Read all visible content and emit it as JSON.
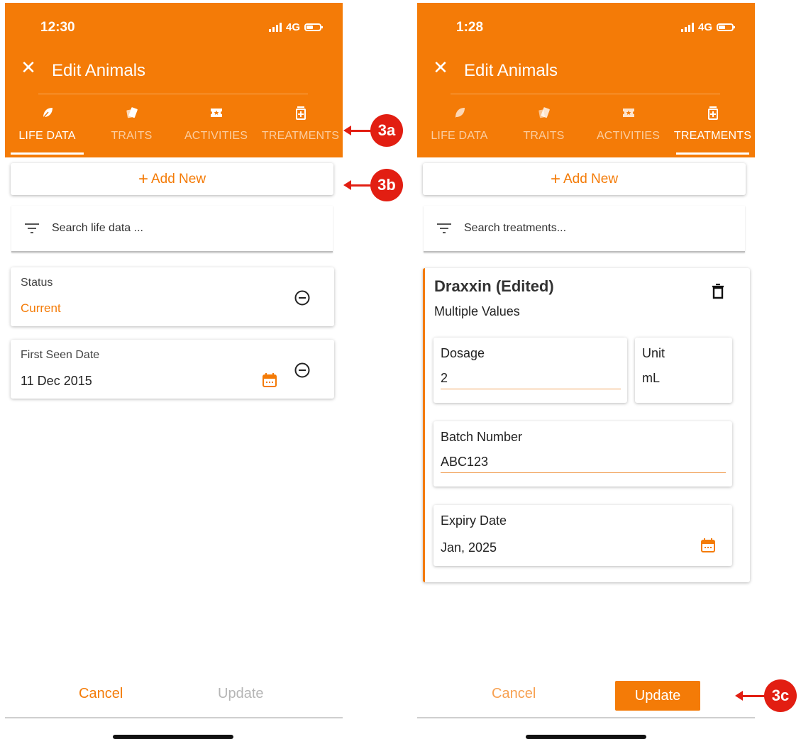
{
  "left": {
    "status": {
      "time": "12:30",
      "network": "4G"
    },
    "title": "Edit Animals",
    "tabs": [
      {
        "label": "LIFE DATA",
        "icon": "leaf-icon",
        "active": true
      },
      {
        "label": "TRAITS",
        "icon": "tags-icon",
        "active": false
      },
      {
        "label": "ACTIVITIES",
        "icon": "ticket-star-icon",
        "active": false
      },
      {
        "label": "TREATMENTS",
        "icon": "medical-kit-icon",
        "active": false
      }
    ],
    "add_new": "Add New",
    "search_placeholder": "Search life data ...",
    "status_card": {
      "label": "Status",
      "value": "Current"
    },
    "date_card": {
      "label": "First Seen Date",
      "value": "11 Dec 2015"
    },
    "cancel": "Cancel",
    "update": "Update"
  },
  "right": {
    "status": {
      "time": "1:28",
      "network": "4G"
    },
    "title": "Edit Animals",
    "tabs": [
      {
        "label": "LIFE DATA",
        "icon": "leaf-icon",
        "active": false
      },
      {
        "label": "TRAITS",
        "icon": "tags-icon",
        "active": false
      },
      {
        "label": "ACTIVITIES",
        "icon": "ticket-star-icon",
        "active": false
      },
      {
        "label": "TREATMENTS",
        "icon": "medical-kit-icon",
        "active": true
      }
    ],
    "add_new": "Add New",
    "search_placeholder": "Search treatments...",
    "treatment": {
      "name": "Draxxin (Edited)",
      "subtitle": "Multiple Values",
      "dosage_label": "Dosage",
      "dosage_value": "2",
      "unit_label": "Unit",
      "unit_value": "mL",
      "batch_label": "Batch Number",
      "batch_value": "ABC123",
      "expiry_label": "Expiry Date",
      "expiry_value": "Jan, 2025"
    },
    "cancel": "Cancel",
    "update": "Update"
  },
  "callouts": {
    "a": "3a",
    "b": "3b",
    "c": "3c"
  },
  "colors": {
    "accent": "#f47b07",
    "callout": "#e21e12"
  }
}
